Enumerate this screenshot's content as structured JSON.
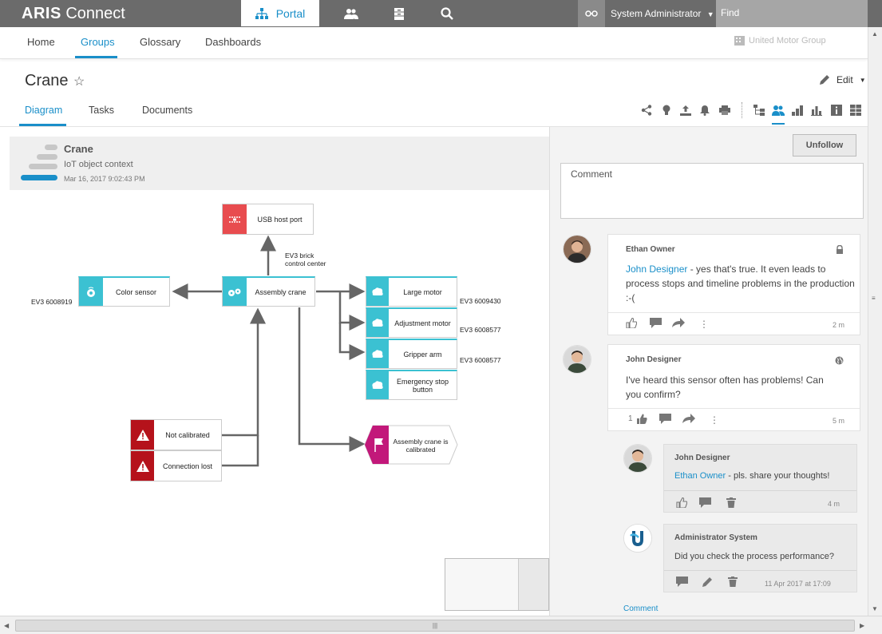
{
  "app": {
    "logo_bold": "ARIS",
    "logo_light": " Connect",
    "portal_label": "Portal",
    "user_name": "System Administrator",
    "find_placeholder": "Find"
  },
  "subnav": {
    "items": [
      "Home",
      "Groups",
      "Glossary",
      "Dashboards"
    ],
    "active": "Groups",
    "org": "United Motor Group"
  },
  "page": {
    "title": "Crane",
    "edit_label": "Edit",
    "tabs": [
      "Diagram",
      "Tasks",
      "Documents"
    ],
    "active_tab": "Diagram"
  },
  "diagram": {
    "header": {
      "title": "Crane",
      "subtitle": "IoT object context",
      "date": "Mar 16, 2017 9:02:43 PM"
    },
    "nodes": {
      "usb": "USB host port",
      "color_sensor": "Color sensor",
      "assembly_crane": "Assembly crane",
      "large_motor": "Large motor",
      "adjustment_motor": "Adjustment motor",
      "gripper_arm": "Gripper arm",
      "emergency_stop": "Emergency stop button",
      "not_calibrated": "Not calibrated",
      "connection_lost": "Connection lost",
      "calibrated": "Assembly crane is calibrated"
    },
    "labels": {
      "ev3_brick": "EV3 brick control center",
      "ev3_6008919": "EV3 6008919",
      "ev3_6009430": "EV3 6009430",
      "ev3_6008577_a": "EV3 6008577",
      "ev3_6008577_b": "EV3 6008577"
    }
  },
  "comments": {
    "unfollow_label": "Unfollow",
    "comment_placeholder": "Comment",
    "items": [
      {
        "author": "Ethan Owner",
        "mention": "John Designer",
        "text": " - yes that's true. It even leads to process stops and timeline problems in the production :-(",
        "likes": "",
        "time": "2 m"
      },
      {
        "author": "John Designer",
        "text": "I've heard this sensor often has problems! Can you confirm?",
        "likes": "1",
        "time": "5 m"
      }
    ],
    "replies": [
      {
        "author": "John Designer",
        "mention": "Ethan Owner",
        "text": " - pls. share your thoughts!",
        "time": "4 m"
      },
      {
        "author": "Administrator System",
        "text": "Did you check the process performance?",
        "time": "11 Apr 2017 at 17:09"
      }
    ],
    "comment_link": "Comment"
  },
  "colors": {
    "accent": "#1a8fc9",
    "cyan": "#3bc1d2",
    "red": "#b5121b",
    "magenta": "#c2187a",
    "usb_red": "#e84c4f"
  }
}
